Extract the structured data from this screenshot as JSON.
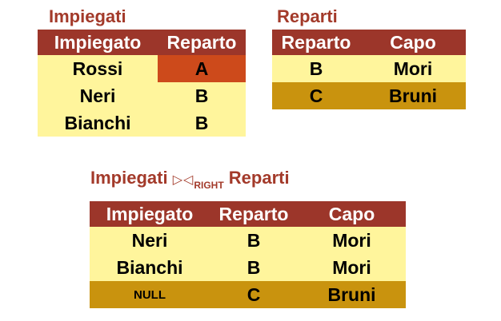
{
  "impiegati": {
    "title": "Impiegati",
    "headers": [
      "Impiegato",
      "Reparto"
    ],
    "rows": [
      [
        "Rossi",
        "A"
      ],
      [
        "Neri",
        "B"
      ],
      [
        "Bianchi",
        "B"
      ]
    ]
  },
  "reparti": {
    "title": "Reparti",
    "headers": [
      "Reparto",
      "Capo"
    ],
    "rows": [
      [
        "B",
        "Mori"
      ],
      [
        "C",
        "Bruni"
      ]
    ]
  },
  "result": {
    "title_left": "Impiegati",
    "operator": "▷◁",
    "operator_sub": "RIGHT",
    "title_right": "Reparti",
    "headers": [
      "Impiegato",
      "Reparto",
      "Capo"
    ],
    "rows": [
      [
        "Neri",
        "B",
        "Mori"
      ],
      [
        "Bianchi",
        "B",
        "Mori"
      ],
      [
        "NULL",
        "C",
        "Bruni"
      ]
    ]
  },
  "colors": {
    "title": "#a33a2a",
    "header_bg": "#9c362a",
    "row_light": "#fff59c",
    "row_dark": "#c9930e",
    "highlight_cell": "#cd4a1b"
  }
}
